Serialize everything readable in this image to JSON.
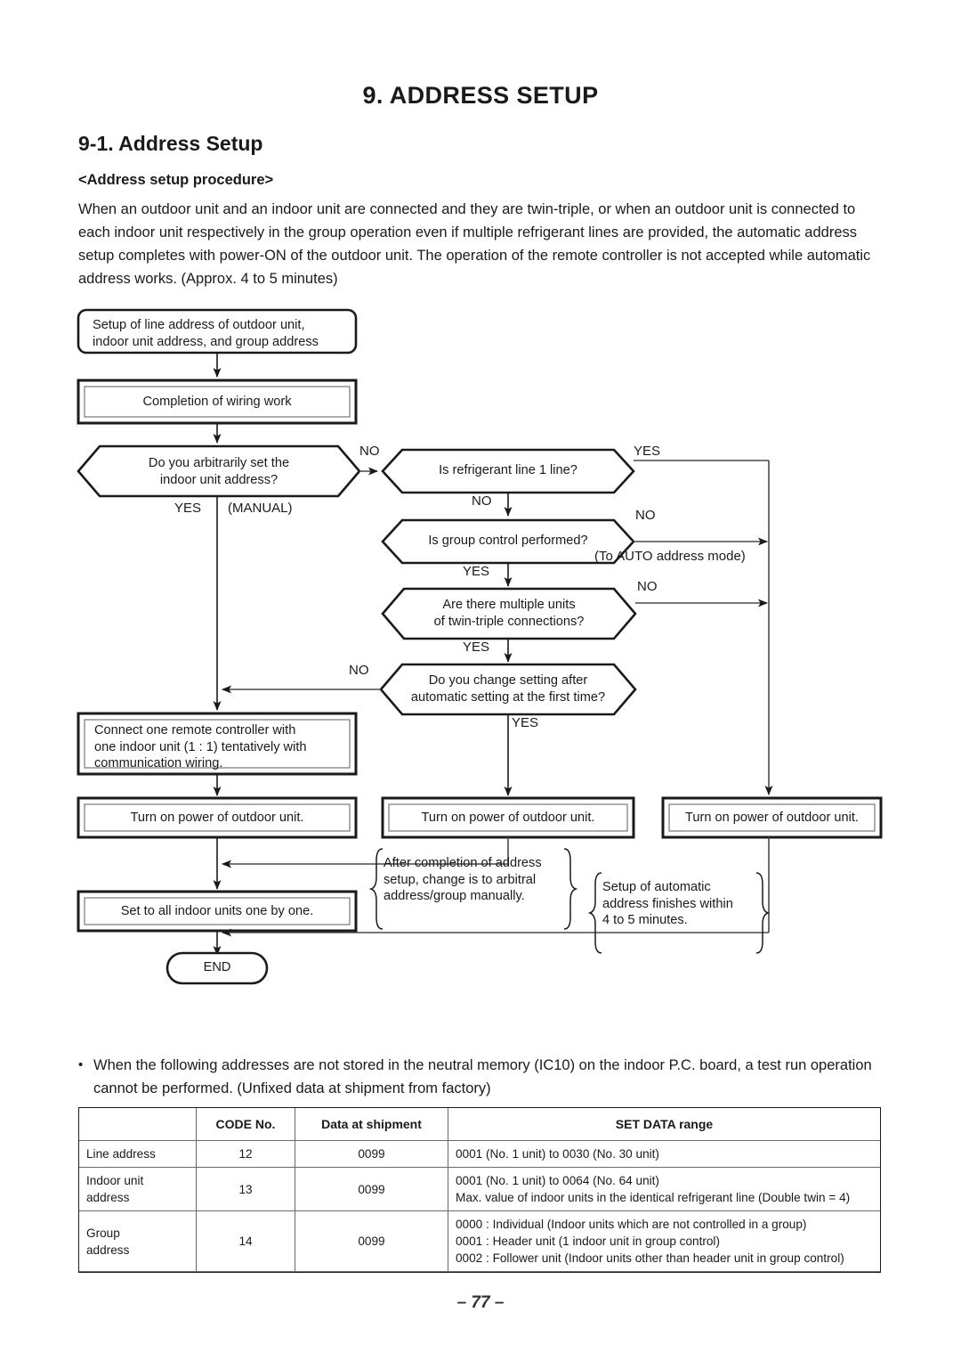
{
  "document": {
    "title": "9.  ADDRESS SETUP",
    "section_title": "9-1.  Address Setup",
    "subsection_title": "<Address setup procedure>",
    "intro_paragraph": "When an outdoor unit and an indoor unit are connected and they are twin-triple, or when an outdoor unit is connected to each indoor unit respectively in the group operation even if multiple refrigerant lines are provided, the automatic address setup completes with power-ON of the outdoor unit. The operation of the remote controller is not accepted while automatic address works. (Approx. 4 to 5 minutes)",
    "page_number": "– 77 –"
  },
  "flowchart": {
    "nodes": {
      "start": "Setup of line address of outdoor unit,\nindoor unit address, and group address",
      "wiring": "Completion of wiring work",
      "q_manual": "Do you arbitrarily set the\nindoor unit address?",
      "q_refline": "Is refrigerant line 1 line?",
      "q_group": "Is group control performed?",
      "q_twin": "Are there multiple units\nof twin-triple connections?",
      "q_change": "Do you change setting after\nautomatic setting at the first time?",
      "connect_rc": "Connect one remote controller with\none indoor unit (1 : 1) tentatively with\ncommunication wiring.",
      "power_left": "Turn on power of outdoor unit.",
      "power_mid": "Turn on power of outdoor unit.",
      "power_right": "Turn on power of outdoor unit.",
      "set_all": "Set to all indoor units one by one.",
      "end": "END"
    },
    "labels": {
      "no_manual": "NO",
      "yes_manual": "YES",
      "manual_note": "(MANUAL)",
      "yes_refline": "YES",
      "no_refline": "NO",
      "no_group": "NO",
      "yes_group": "YES",
      "auto_mode_note": "(To AUTO address mode)",
      "no_twin": "NO",
      "yes_twin": "YES",
      "no_change": "NO",
      "yes_change": "YES"
    },
    "annotations": {
      "manual_change": "After completion of address\nsetup, change is to arbitral\naddress/group manually.",
      "auto_finish": "Setup of automatic\naddress finishes within\n4 to 5 minutes."
    }
  },
  "note": {
    "bullet": "•",
    "text": "When the following addresses are not stored in the neutral memory (IC10) on the indoor P.C. board, a test run operation cannot be performed. (Unfixed data at shipment from factory)"
  },
  "table": {
    "headers": [
      "",
      "CODE No.",
      "Data at shipment",
      "SET DATA range"
    ],
    "rows": [
      {
        "name": "Line address",
        "code": "12",
        "shipment": "0099",
        "range": "0001 (No. 1 unit) to 0030 (No. 30 unit)"
      },
      {
        "name": "Indoor unit\naddress",
        "code": "13",
        "shipment": "0099",
        "range": "0001 (No. 1 unit) to 0064 (No. 64 unit)\nMax. value of indoor units in the identical refrigerant line (Double twin = 4)"
      },
      {
        "name": "Group\naddress",
        "code": "14",
        "shipment": "0099",
        "range": "0000 : Individual (Indoor units which are not controlled in a group)\n0001 : Header unit (1 indoor unit in group control)\n0002 : Follower unit (Indoor units other than header unit in group control)"
      }
    ]
  },
  "colors": {
    "ink": "#1a1a1a",
    "line": "#4a4a4a",
    "paper": "#ffffff"
  }
}
